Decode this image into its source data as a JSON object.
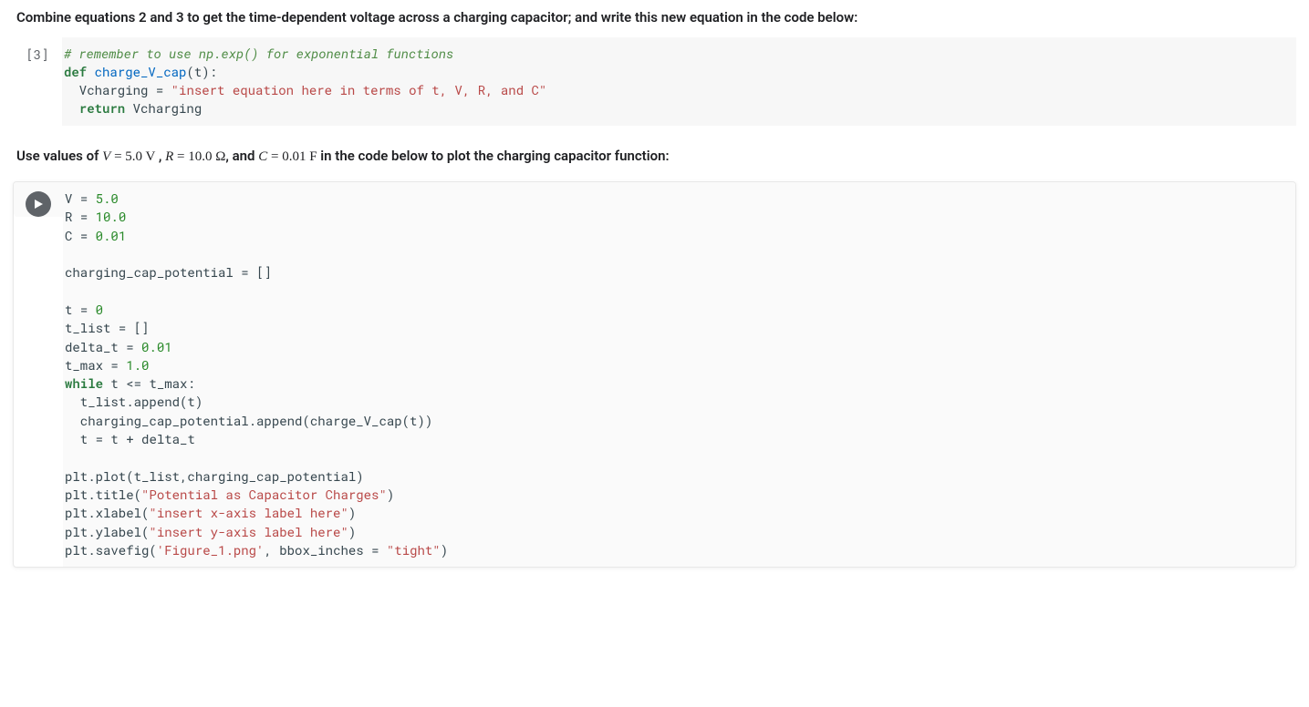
{
  "text1": {
    "prefix": "Combine equations 2 and 3 to get the time-dependent voltage across a charging capacitor; and write this new equation in the code below:"
  },
  "cell1": {
    "prompt": "[3]",
    "c1": "# remember to use np.exp() for exponential functions",
    "c2_def": "def",
    "c2_name": "charge_V_cap",
    "c2_rest": "(t):",
    "c3_var": "  Vcharging ",
    "c3_eq": "=",
    "c3_sp": " ",
    "c3_str": "\"insert equation here in terms of t, V, R, and C\"",
    "c4_ret": "  return",
    "c4_rest": " Vcharging"
  },
  "text2": {
    "a": "Use values of ",
    "V": "V",
    "eq1": " = 5.0 V ",
    "comma1": ", ",
    "R": "R",
    "eq2": " = 10.0 Ω",
    "comma2": ", and ",
    "C": "C",
    "eq3": " = 0.01 F",
    "b": " in the code below to plot the charging capacitor function:"
  },
  "cell2": {
    "l1a": "V ",
    "l1b": "=",
    "l1c": " ",
    "l1d": "5.0",
    "l2a": "R ",
    "l2b": "=",
    "l2c": " ",
    "l2d": "10.0",
    "l3a": "C ",
    "l3b": "=",
    "l3c": " ",
    "l3d": "0.01",
    "l4": "",
    "l5a": "charging_cap_potential ",
    "l5b": "=",
    "l5c": " []",
    "l6": "",
    "l7a": "t ",
    "l7b": "=",
    "l7c": " ",
    "l7d": "0",
    "l8a": "t_list ",
    "l8b": "=",
    "l8c": " []",
    "l9a": "delta_t ",
    "l9b": "=",
    "l9c": " ",
    "l9d": "0.01",
    "l10a": "t_max ",
    "l10b": "=",
    "l10c": " ",
    "l10d": "1.0",
    "l11a": "while",
    "l11b": " t ",
    "l11c": "<=",
    "l11d": " t_max:",
    "l12a": "  t_list.append(t)",
    "l13a": "  charging_cap_potential.append(charge_V_cap(t))",
    "l14a": "  t ",
    "l14b": "=",
    "l14c": " t ",
    "l14d": "+",
    "l14e": " delta_t",
    "l15": "",
    "l16a": "plt.plot(t_list,charging_cap_potential)",
    "l17a": "plt.title(",
    "l17b": "\"Potential as Capacitor Charges\"",
    "l17c": ")",
    "l18a": "plt.xlabel(",
    "l18b": "\"insert x-axis label here\"",
    "l18c": ")",
    "l19a": "plt.ylabel(",
    "l19b": "\"insert y-axis label here\"",
    "l19c": ")",
    "l20a": "plt.savefig(",
    "l20b": "'Figure_1.png'",
    "l20c": ", bbox_inches ",
    "l20d": "=",
    "l20e": " ",
    "l20f": "\"tight\"",
    "l20g": ")"
  }
}
